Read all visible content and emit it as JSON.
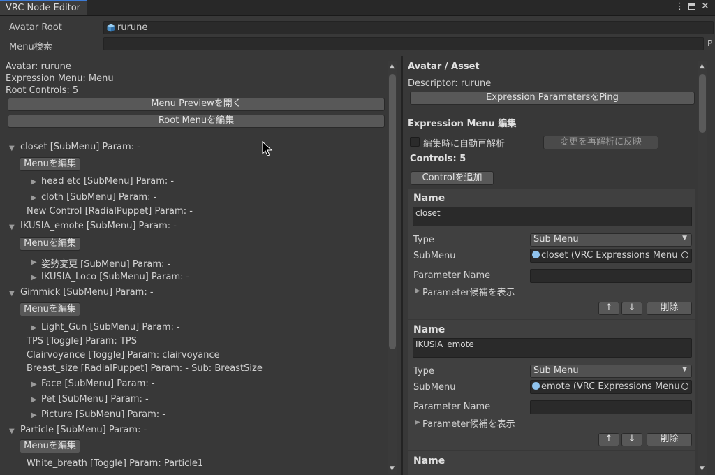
{
  "window": {
    "title": "VRC Node Editor",
    "menu_icon": "kebab-icon",
    "maximize_icon": "maximize-icon",
    "close_icon": "close-icon"
  },
  "header": {
    "avatar_root_label": "Avatar Root",
    "avatar_root_value": "rurune",
    "menu_search_label": "Menu検索",
    "menu_search_value": "",
    "edge_char": "P"
  },
  "left": {
    "avatar_line": "Avatar: rurune",
    "expr_menu_line": "Expression Menu: Menu",
    "root_controls_line": "Root Controls: 5",
    "preview_button": "Menu Previewを開く",
    "root_edit_button": "Root Menuを編集",
    "edit_button": "Menuを編集",
    "tree": {
      "closet": "closet [SubMenu] Param: -",
      "head_etc": "head etc [SubMenu] Param: -",
      "cloth": "cloth [SubMenu] Param: -",
      "new_control": "New Control [RadialPuppet] Param: -",
      "ikusia_emote": "IKUSIA_emote [SubMenu] Param: -",
      "shisei": "姿勢変更 [SubMenu] Param: -",
      "ikusia_loco": "IKUSIA_Loco [SubMenu] Param: -",
      "gimmick": "Gimmick [SubMenu] Param: -",
      "light_gun": "Light_Gun [SubMenu] Param: -",
      "tps": "TPS [Toggle] Param: TPS",
      "clairvoyance": "Clairvoyance [Toggle] Param: clairvoyance",
      "breast_size": "Breast_size [RadialPuppet] Param: - Sub: BreastSize",
      "face": "Face [SubMenu] Param: -",
      "pet": "Pet [SubMenu] Param: -",
      "picture": "Picture [SubMenu] Param: -",
      "particle": "Particle [SubMenu] Param: -",
      "white_breath": "White_breath [Toggle] Param: Particle1"
    }
  },
  "right": {
    "section_title": "Avatar / Asset",
    "descriptor_line": "Descriptor: rurune",
    "ping_button": "Expression ParametersをPing",
    "menu_edit_title": "Expression Menu 編集",
    "auto_reparse_label": "編集時に自動再解析",
    "auto_reparse_checked": false,
    "apply_button": "変更を再解析に反映",
    "controls_line": "Controls: 5",
    "add_control_button": "Controlを追加",
    "labels": {
      "name": "Name",
      "type": "Type",
      "submenu": "SubMenu",
      "param_name": "Parameter Name",
      "show_candidates": "Parameter候補を表示",
      "up": "↑",
      "down": "↓",
      "delete": "削除"
    },
    "controls": [
      {
        "name": "closet",
        "type": "Sub Menu",
        "submenu": "closet (VRC Expressions Menu",
        "param": ""
      },
      {
        "name": "IKUSIA_emote",
        "type": "Sub Menu",
        "submenu": "emote (VRC Expressions Menu",
        "param": ""
      }
    ]
  }
}
